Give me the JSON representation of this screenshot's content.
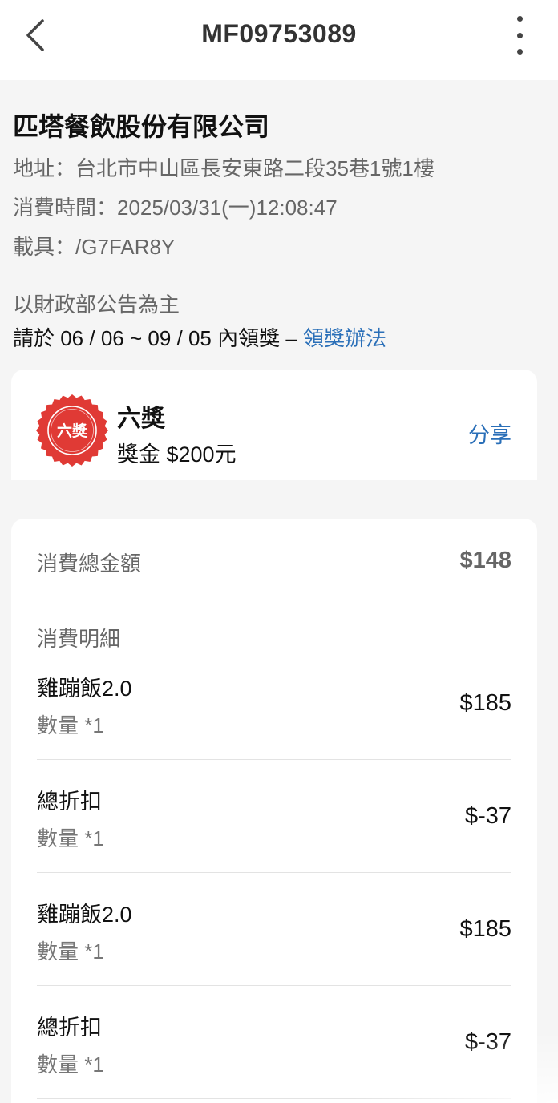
{
  "header": {
    "title": "MF09753089"
  },
  "invoice": {
    "merchant": "匹塔餐飲股份有限公司",
    "address": "地址：台北市中山區長安東路二段35巷1號1樓",
    "time": "消費時間：2025/03/31(一)12:08:47",
    "carrier": "載具：/G7FAR8Y"
  },
  "notice": {
    "note": "以財政部公告為主",
    "claim_text": "請於 06 / 06 ~ 09 / 05 內領獎 – ",
    "claim_link": "領獎辦法"
  },
  "prize": {
    "badge_text": "六獎",
    "name": "六獎",
    "amount": "獎金 $200元",
    "share": "分享",
    "badge_color": "#e03a35"
  },
  "details": {
    "total_label": "消費總金額",
    "total_value": "$148",
    "section_label": "消費明細",
    "items": [
      {
        "name": "雞蹦飯2.0",
        "qty": "數量 *1",
        "price": "$185"
      },
      {
        "name": "總折扣",
        "qty": "數量 *1",
        "price": "$-37"
      },
      {
        "name": "雞蹦飯2.0",
        "qty": "數量 *1",
        "price": "$185"
      },
      {
        "name": "總折扣",
        "qty": "數量 *1",
        "price": "$-37"
      }
    ]
  },
  "icons": {
    "back": "chevron-left-icon",
    "more": "more-vertical-icon",
    "badge": "prize-seal-icon"
  },
  "colors": {
    "link": "#2a6fb8",
    "background": "#f5f5f5"
  }
}
